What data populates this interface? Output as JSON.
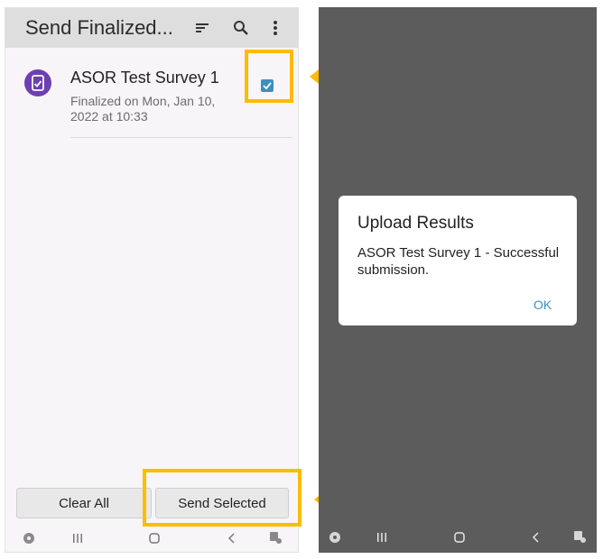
{
  "left_screen": {
    "title": "Send Finalized...",
    "icons": [
      "sort-icon",
      "search-icon",
      "more-vert-icon"
    ],
    "form": {
      "name": "ASOR Test Survey 1",
      "status": "Finalized on Mon, Jan 10, 2022 at 10:33",
      "checked": true
    },
    "buttons": {
      "clear_all": "Clear All",
      "send_selected": "Send Selected"
    },
    "nav_icons": [
      "game-launcher-icon",
      "recent-apps-icon",
      "home-icon",
      "back-icon",
      "accessibility-icon"
    ]
  },
  "right_screen": {
    "dialog": {
      "title": "Upload Results",
      "message": "ASOR Test Survey 1 - Successful submission.",
      "ok": "OK"
    },
    "nav_icons": [
      "game-launcher-icon",
      "recent-apps-icon",
      "home-icon",
      "back-icon",
      "accessibility-icon"
    ]
  },
  "colors": {
    "highlight": "#ffbb00",
    "accent": "#3e8ec0",
    "avatar": "#6d3fb0",
    "dim_background": "#5c5c5c",
    "appbar": "#dedede"
  }
}
